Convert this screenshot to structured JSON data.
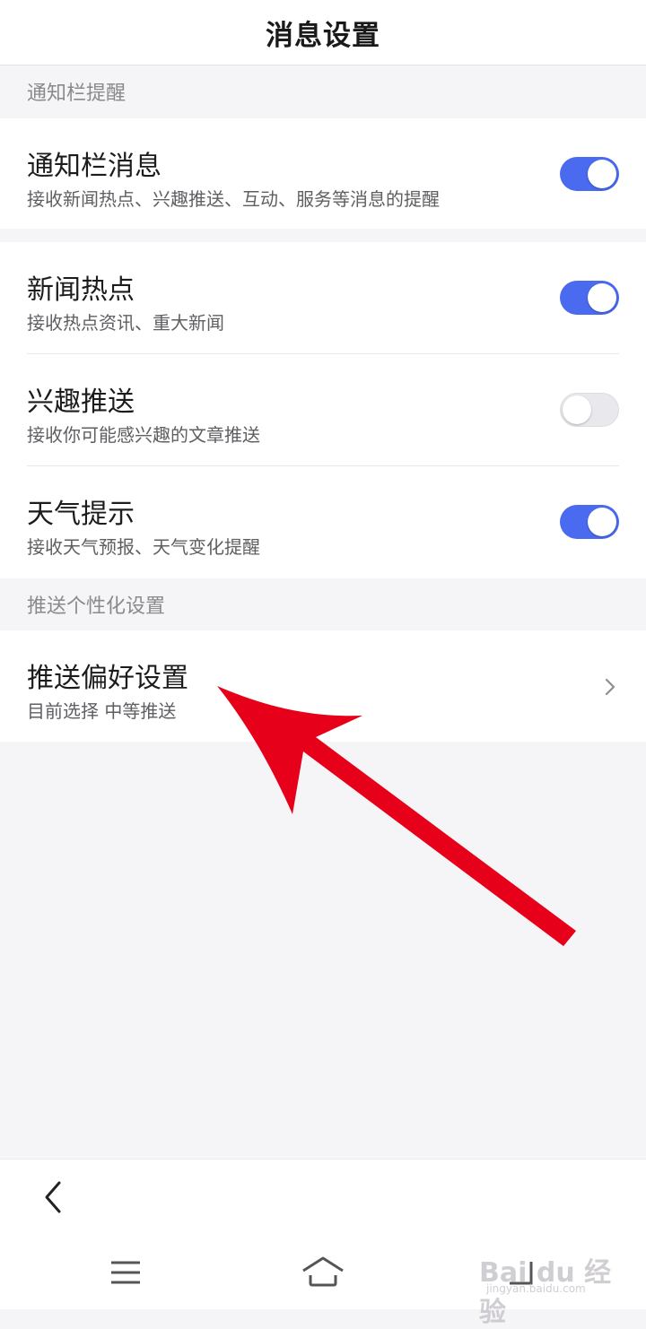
{
  "title": "消息设置",
  "sections": {
    "notify_header": "通知栏提醒",
    "push_header": "推送个性化设置"
  },
  "settings": [
    {
      "label": "通知栏消息",
      "desc": "接收新闻热点、兴趣推送、互动、服务等消息的提醒",
      "enabled": true
    },
    {
      "label": "新闻热点",
      "desc": "接收热点资讯、重大新闻",
      "enabled": true
    },
    {
      "label": "兴趣推送",
      "desc": "接收你可能感兴趣的文章推送",
      "enabled": false
    },
    {
      "label": "天气提示",
      "desc": "接收天气预报、天气变化提醒",
      "enabled": true
    }
  ],
  "push_pref": {
    "label": "推送偏好设置",
    "desc": "目前选择 中等推送"
  },
  "icons": {
    "back": "back-chevron-icon",
    "menu": "menu-icon",
    "home": "home-icon",
    "recent": "recent-apps-icon",
    "chevron": "chevron-right-icon"
  },
  "colors": {
    "toggle_on": "#4a6af0",
    "toggle_off": "#e9e8ec",
    "annotation_arrow": "#e6001a"
  },
  "watermark": {
    "text": "Bai du 经验",
    "url": "jingyan.baidu.com"
  }
}
